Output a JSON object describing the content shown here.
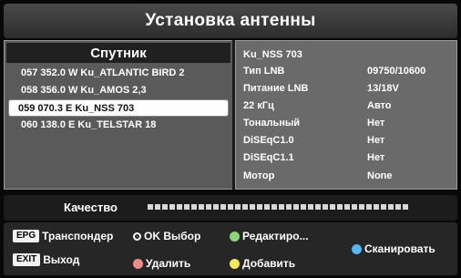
{
  "title": "Установка антенны",
  "satellites": {
    "header": "Спутник",
    "items": [
      {
        "label": "057 352.0 W Ku_ATLANTIC BIRD 2",
        "selected": false
      },
      {
        "label": "058 356.0 W Ku_AMOS 2,3",
        "selected": false
      },
      {
        "label": "059 070.3 E Ku_NSS 703",
        "selected": true
      },
      {
        "label": "060 138.0 E Ku_TELSTAR 18",
        "selected": false
      }
    ]
  },
  "details": {
    "name": "Ku_NSS 703",
    "rows": [
      {
        "label": "Тип LNB",
        "value": "09750/10600"
      },
      {
        "label": "Питание LNB",
        "value": "13/18V"
      },
      {
        "label": "22 кГц",
        "value": "Авто"
      },
      {
        "label": "Тональный",
        "value": "Нет"
      },
      {
        "label": "DiSEqC1.0",
        "value": "Нет"
      },
      {
        "label": "DiSEqC1.1",
        "value": "Нет"
      },
      {
        "label": "Мотор",
        "value": "None"
      }
    ]
  },
  "quality": {
    "label": "Качество",
    "segments": 36
  },
  "footer": {
    "epg_key": "EPG",
    "epg_label": "Транспондер",
    "exit_key": "EXIT",
    "exit_label": "Выход",
    "ok_label": "OK Выбор",
    "green_label": "Редактиро...",
    "red_label": "Удалить",
    "yellow_label": "Добавить",
    "blue_label": "Сканировать"
  },
  "colors": {
    "green": "#8fd47a",
    "red": "#f08a8a",
    "yellow": "#f2ea5a",
    "blue": "#5ab4f0"
  }
}
